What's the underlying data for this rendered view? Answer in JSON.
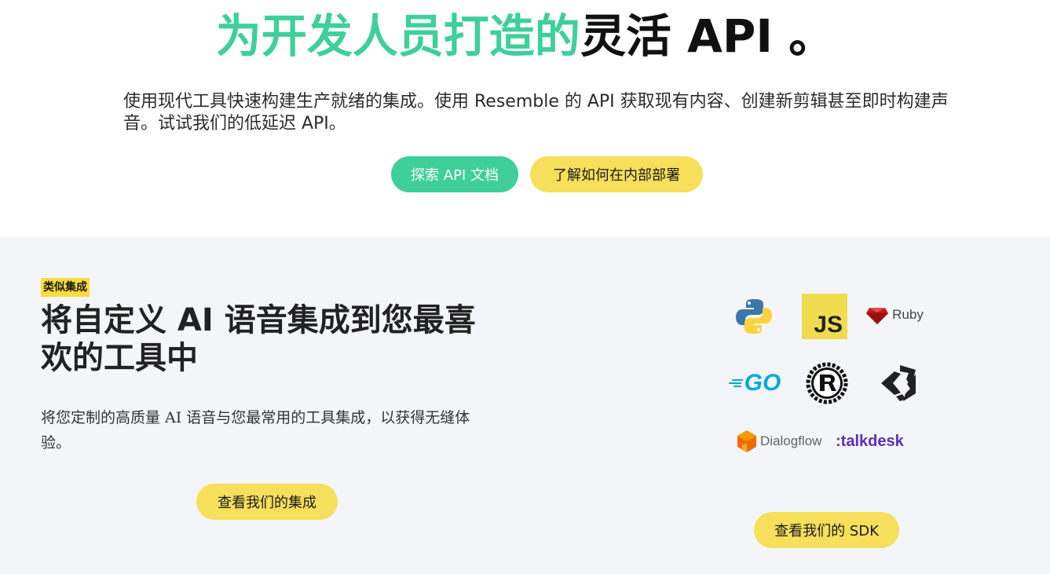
{
  "hero": {
    "title_accent": "为开发人员打造的",
    "title_rest": "灵活 API 。",
    "description": "使用现代工具快速构建生产就绪的集成。使用 Resemble 的 API 获取现有内容、创建新剪辑甚至即时构建声音。试试我们的低延迟 API。",
    "btn_docs": "探索 API 文档",
    "btn_onprem": "了解如何在内部部署"
  },
  "integrations": {
    "tag": "类似集成",
    "title": "将自定义 AI 语音集成到您最喜欢的工具中",
    "description": "将您定制的高质量 AI 语音与您最常用的工具集成，以获得无缝体验。",
    "btn_integrations": "查看我们的集成",
    "btn_sdk": "查看我们的 SDK",
    "logos": {
      "js": "JS",
      "ruby": "Ruby",
      "go": "GO",
      "dialogflow": "Dialogflow",
      "talkdesk": ":talkdesk"
    }
  },
  "colors": {
    "accent_green": "#3ecf9a",
    "accent_yellow": "#f5df5b",
    "section_bg": "#f4f5f9"
  }
}
